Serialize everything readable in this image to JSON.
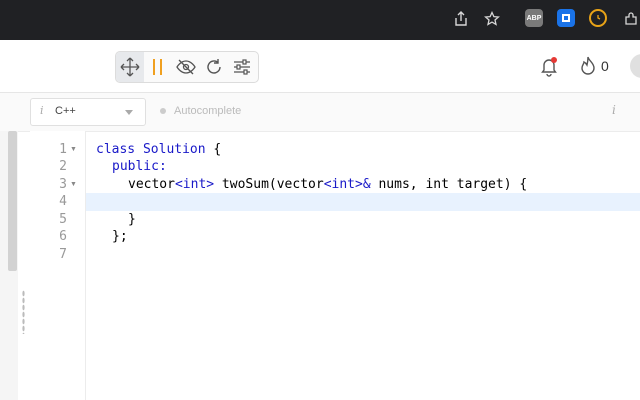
{
  "browser": {
    "extensions": [
      {
        "name": "adblock-extension-icon",
        "label": "ABP",
        "color": "#7a7a7a"
      },
      {
        "name": "shield-extension-icon",
        "label": "",
        "color": "#1a73e8"
      },
      {
        "name": "timer-extension-icon",
        "label": "",
        "color": "#e8a317"
      }
    ]
  },
  "toolbar": {
    "buttons": [
      "move",
      "pause",
      "hide",
      "reset",
      "settings"
    ],
    "notification_count": "0",
    "accent_color": "#f0a020"
  },
  "editor": {
    "language": "C++",
    "autocomplete_label": "Autocomplete",
    "info_glyph": "i",
    "line_numbers": [
      "1",
      "2",
      "3",
      "4",
      "5",
      "6",
      "7"
    ],
    "lines": {
      "l1_kw": "class Solution",
      "l1_rest": " {",
      "l2_kw": "public:",
      "l3_a": "vector",
      "l3_b": "<int>",
      "l3_c": " twoSum(vector",
      "l3_d": "<int>&",
      "l3_e": " nums, int target) {",
      "l5": "}",
      "l6": "};"
    },
    "current_line": "4"
  }
}
